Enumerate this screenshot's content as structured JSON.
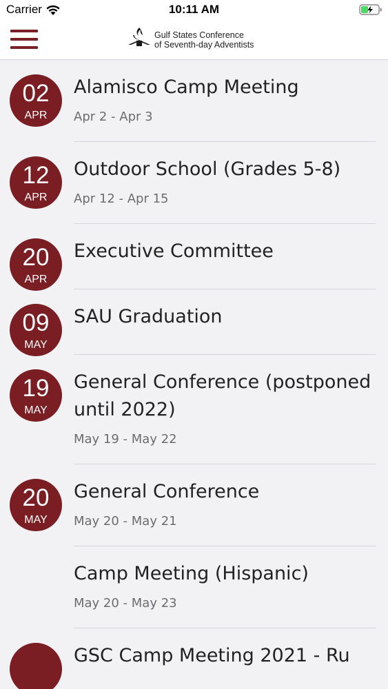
{
  "status_bar": {
    "carrier": "Carrier",
    "time": "10:11 AM"
  },
  "header": {
    "menu_icon": "hamburger-menu-icon",
    "logo_line1": "Gulf States Conference",
    "logo_line2": "of Seventh-day Adventists",
    "logo_mark": "sda-flame-logo"
  },
  "colors": {
    "brand": "#7a1e23",
    "background": "#f2f2f4",
    "divider": "#d6d6da",
    "battery": "#4cd964"
  },
  "events": [
    {
      "day": "02",
      "month": "APR",
      "title": "Alamisco Camp Meeting",
      "dates": "Apr 2 - Apr 3"
    },
    {
      "day": "12",
      "month": "APR",
      "title": "Outdoor School (Grades 5-8)",
      "dates": "Apr 12 - Apr 15"
    },
    {
      "day": "20",
      "month": "APR",
      "title": "Executive Committee",
      "dates": ""
    },
    {
      "day": "09",
      "month": "MAY",
      "title": "SAU Graduation",
      "dates": ""
    },
    {
      "day": "19",
      "month": "MAY",
      "title": "General Conference (postponed until  2022)",
      "dates": "May 19 - May 22"
    },
    {
      "day": "20",
      "month": "MAY",
      "title": "General Conference",
      "dates": "May 20 - May 21"
    },
    {
      "day": "",
      "month": "",
      "title": "Camp Meeting (Hispanic)",
      "dates": "May 20 - May 23"
    },
    {
      "day": "",
      "month": "",
      "title": "GSC Camp Meeting 2021 - Ru",
      "dates": ""
    }
  ]
}
